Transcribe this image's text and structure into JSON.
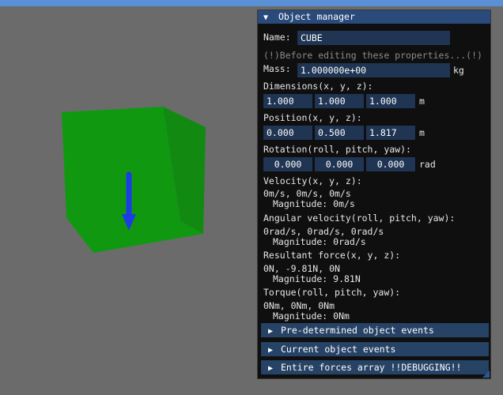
{
  "colors": {
    "background": "#6b6b6b",
    "cube_front": "#109910",
    "cube_side": "#128a12",
    "cube_top": "#16a616",
    "vector": "#1c3de6",
    "panel_title": "#294a7a",
    "field_bg": "#1f3553",
    "header_bar": "#264265"
  },
  "panel": {
    "title": "Object manager",
    "name_label": "Name:",
    "name_value": "CUBE",
    "warning": "(!)Before editing these properties...(!)",
    "mass_label": "Mass:",
    "mass_value": "1.000000e+00",
    "mass_unit": "kg",
    "dimensions_label": "Dimensions(x, y, z):",
    "dimensions": [
      "1.000",
      "1.000",
      "1.000"
    ],
    "dimensions_unit": "m",
    "position_label": "Position(x, y, z):",
    "position": [
      "0.000",
      "0.500",
      "1.817"
    ],
    "position_unit": "m",
    "rotation_label": "Rotation(roll, pitch, yaw):",
    "rotation": [
      "0.000",
      "0.000",
      "0.000"
    ],
    "rotation_unit": "rad",
    "velocity_label": "Velocity(x, y, z):",
    "velocity_value": "0m/s, 0m/s, 0m/s",
    "velocity_magnitude": "Magnitude: 0m/s",
    "angular_label": "Angular velocity(roll, pitch, yaw):",
    "angular_value": "0rad/s, 0rad/s, 0rad/s",
    "angular_magnitude": "Magnitude: 0rad/s",
    "force_label": "Resultant force(x, y, z):",
    "force_value": "0N, -9.81N, 0N",
    "force_magnitude": "Magnitude: 9.81N",
    "torque_label": "Torque(roll, pitch, yaw):",
    "torque_value": "0Nm, 0Nm, 0Nm",
    "torque_magnitude": "Magnitude: 0Nm",
    "sections": [
      "Pre-determined object events",
      "Current object events",
      "Entire forces array !!DEBUGGING!!"
    ]
  }
}
